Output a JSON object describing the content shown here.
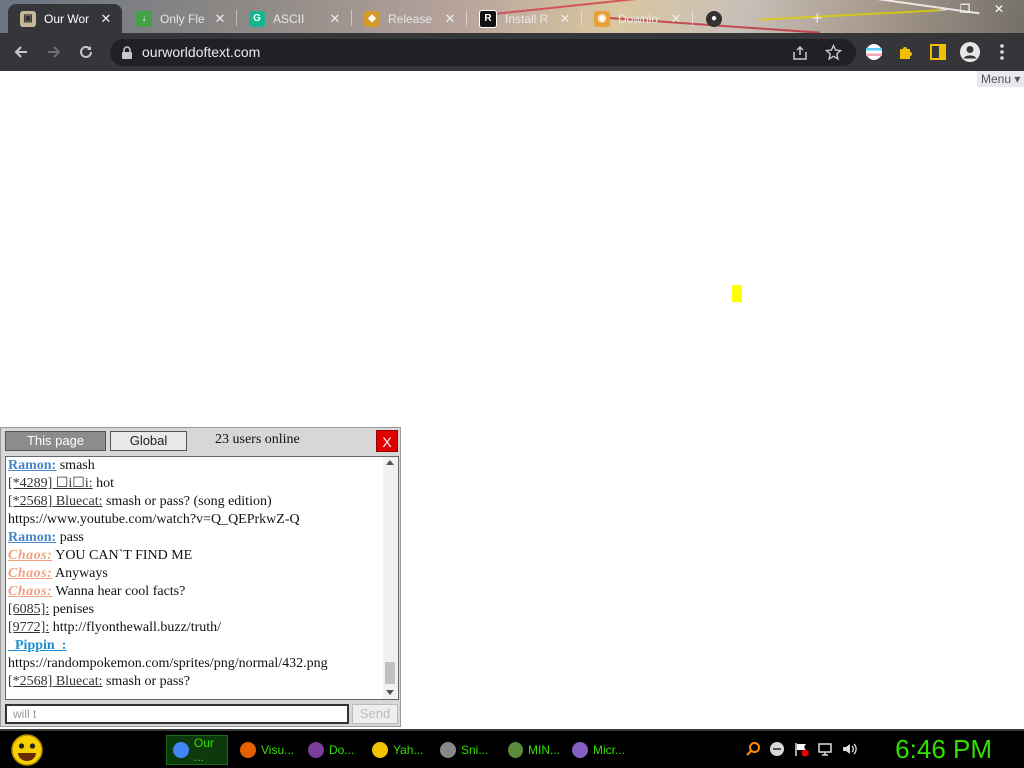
{
  "browser": {
    "tabs": [
      {
        "title": "Our Wor",
        "active": true
      },
      {
        "title": "Only Fle",
        "active": false
      },
      {
        "title": "ASCII",
        "active": false
      },
      {
        "title": "Release",
        "active": false
      },
      {
        "title": "Install R",
        "active": false
      },
      {
        "title": "Downlo",
        "active": false
      }
    ],
    "url": "ourworldoftext.com"
  },
  "page": {
    "menu_label": "Menu ▾"
  },
  "chat": {
    "tab_page": "This page",
    "tab_global": "Global",
    "online": "23 users online",
    "close": "X",
    "messages": [
      {
        "user": "Ramon:",
        "style": "blue",
        "text": " smash"
      },
      {
        "user": "[*4289] ☐i☐i:",
        "style": "plain",
        "text": " hot"
      },
      {
        "user": "[*2568] Bluecat:",
        "style": "plain",
        "text": " smash or pass? (song edition) https://www.youtube.com/watch?v=Q_QEPrkwZ-Q"
      },
      {
        "user": "Ramon:",
        "style": "blue",
        "text": " pass"
      },
      {
        "user": "Chaos:",
        "style": "chaos",
        "text": " YOU CAN`T FIND ME"
      },
      {
        "user": "Chaos:",
        "style": "chaos",
        "text": " Anyways"
      },
      {
        "user": "Chaos:",
        "style": "chaos",
        "text": " Wanna hear cool facts?"
      },
      {
        "user": "[6085]:",
        "style": "plain",
        "text": " penises"
      },
      {
        "user": "[9772]:",
        "style": "plain",
        "text": " http://flyonthewall.buzz/truth/"
      },
      {
        "user": "_Pippin_:",
        "style": "pippin",
        "text": " https://randompokemon.com/sprites/png/normal/432.png"
      },
      {
        "user": "[*2568] Bluecat:",
        "style": "plain",
        "text": " smash or pass?"
      }
    ],
    "input_value": "will t",
    "send_label": "Send"
  },
  "taskbar": {
    "items": [
      {
        "label": "Our ...",
        "icon": "chrome-icon",
        "color": "#4285f4",
        "active": true
      },
      {
        "label": "Visu...",
        "icon": "firefox-icon",
        "color": "#e66000",
        "active": false
      },
      {
        "label": "Do...",
        "icon": "document-icon",
        "color": "#7a3f9a",
        "active": false
      },
      {
        "label": "Yah...",
        "icon": "yahoo-messenger-icon",
        "color": "#f2c200",
        "active": false
      },
      {
        "label": "Sni...",
        "icon": "snipping-tool-icon",
        "color": "#888888",
        "active": false
      },
      {
        "label": "MIN...",
        "icon": "minecraft-icon",
        "color": "#5a8a3a",
        "active": false
      },
      {
        "label": "Micr...",
        "icon": "visual-studio-icon",
        "color": "#865fc5",
        "active": false
      }
    ],
    "clock": "6:46 PM"
  },
  "colors": {
    "cursor": "#ffff00",
    "clock": "#32e000",
    "chat_close": "#e00000"
  }
}
